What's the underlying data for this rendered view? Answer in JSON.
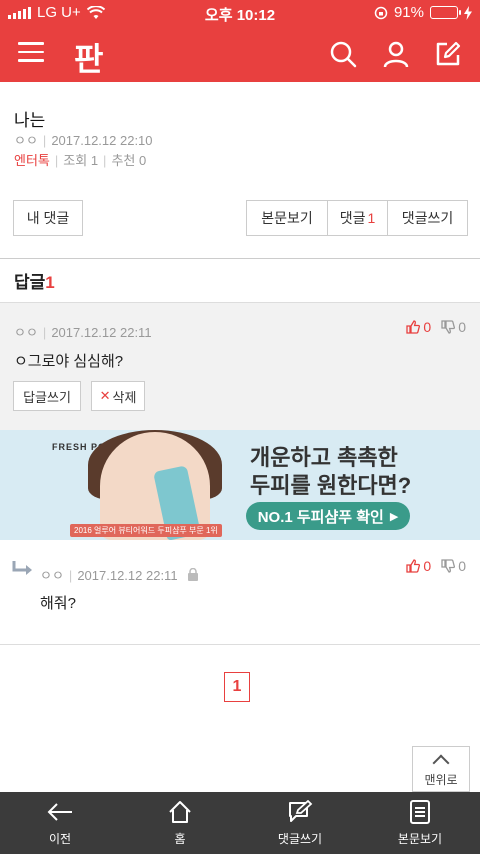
{
  "status_bar": {
    "carrier": "LG U+",
    "time": "오후 10:12",
    "battery": "91%",
    "battery_level": 0.91
  },
  "header": {
    "logo": "판",
    "icons": [
      "menu-icon",
      "search-icon",
      "user-icon",
      "edit-icon"
    ]
  },
  "post": {
    "title": "나는",
    "author": "ㅇㅇ",
    "date": "2017.12.12 22:10",
    "category": "엔터톡",
    "views": "조회 1",
    "recommends": "추천 0"
  },
  "actions": {
    "my_comments": "내 댓글",
    "view_post": "본문보기",
    "comments_label": "댓글",
    "comments_count": "1",
    "write_comment": "댓글쓰기"
  },
  "replies": {
    "label": "답글",
    "count": "1"
  },
  "comments": [
    {
      "author": "ㅇㅇ",
      "date": "2017.12.12 22:11",
      "text": "ㅇ그로야 심심해?",
      "likes": "0",
      "dislikes": "0",
      "reply_btn": "답글쓰기",
      "delete_btn": "삭제"
    },
    {
      "author": "ㅇㅇ",
      "date": "2017.12.12 22:11",
      "text": "해줘?",
      "likes": "0",
      "dislikes": "0"
    }
  ],
  "ad": {
    "brand": "FRESH POP",
    "award": "2016 얼루어 뷰티어워드 두피샴푸 부문 1위",
    "headline1": "개운하고 촉촉한",
    "headline2": "두피를 원한다면?",
    "cta": "NO.1 두피샴푸 확인"
  },
  "pagination": {
    "current": "1"
  },
  "to_top": "맨위로",
  "bottom_nav": [
    {
      "label": "이전",
      "icon": "back-arrow-icon"
    },
    {
      "label": "홈",
      "icon": "home-icon"
    },
    {
      "label": "댓글쓰기",
      "icon": "comment-write-icon"
    },
    {
      "label": "본문보기",
      "icon": "document-icon"
    }
  ]
}
